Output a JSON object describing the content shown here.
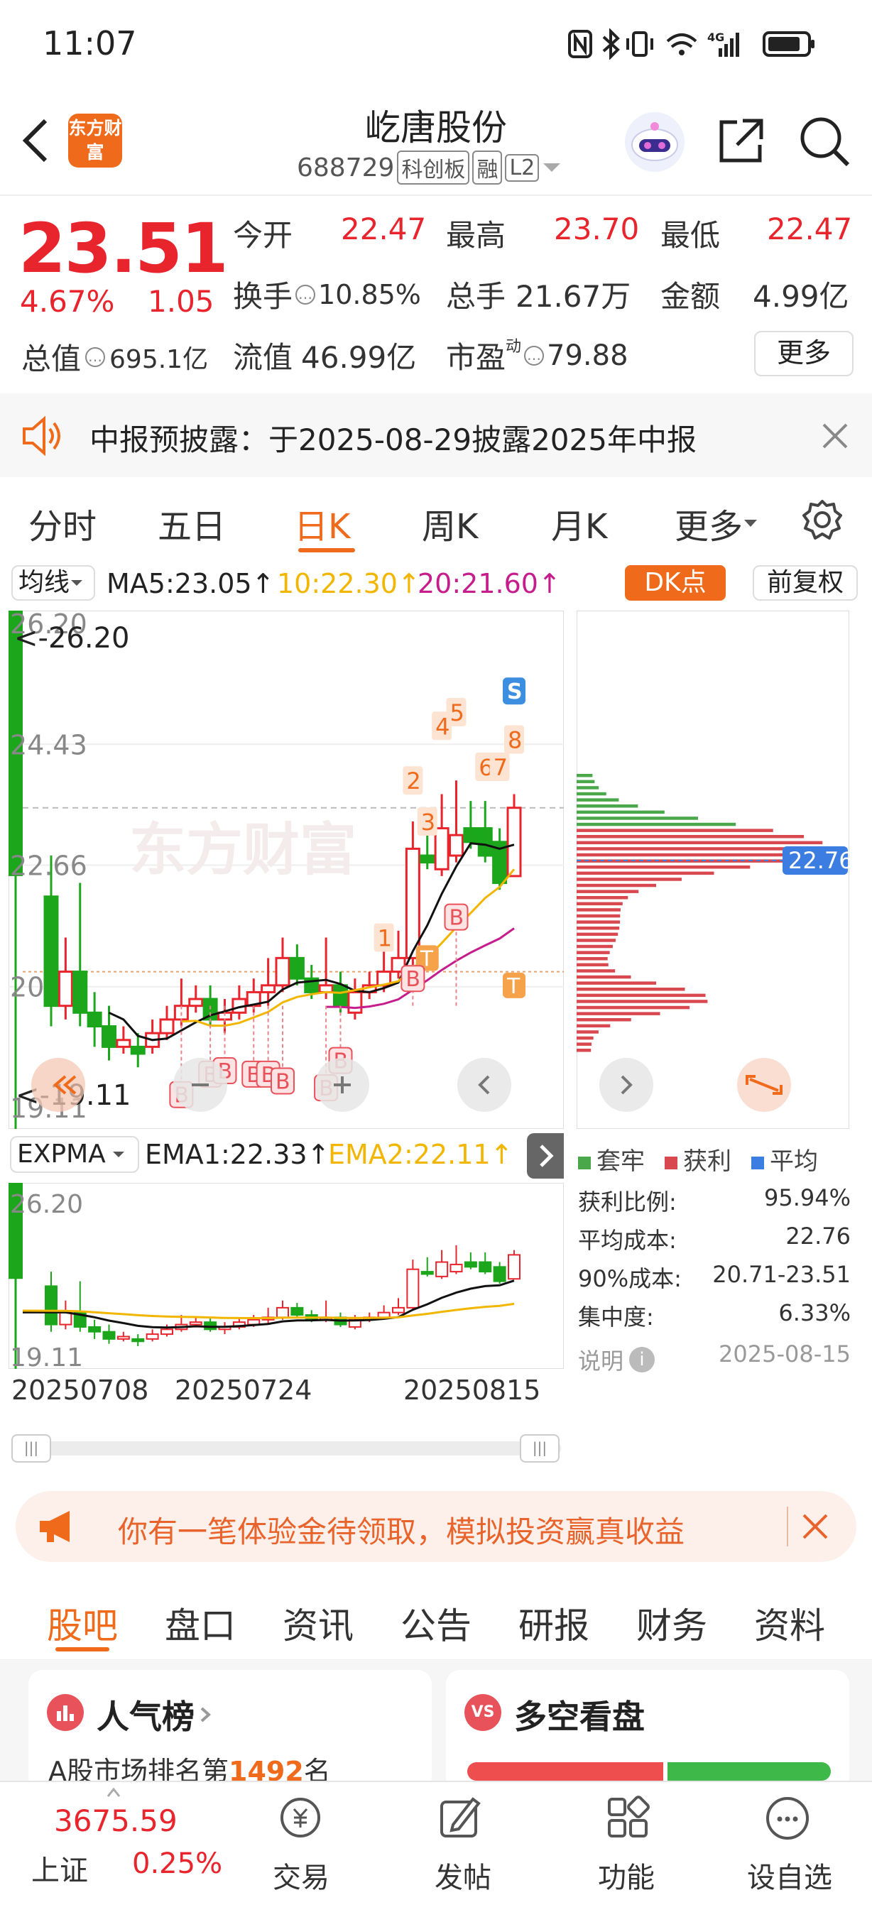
{
  "status": {
    "time": "11:07",
    "network": "4G"
  },
  "header": {
    "back_icon": "back-arrow-icon",
    "logo_text": "东方财富",
    "stock_name": "屹唐股份",
    "code": "688729",
    "badges": [
      "科创板",
      "融",
      "L2"
    ]
  },
  "quote": {
    "price": "23.51",
    "change_pct": "4.67%",
    "change": "1.05",
    "open_label": "今开",
    "open": "22.47",
    "high_label": "最高",
    "high": "23.70",
    "low_label": "最低",
    "low": "22.47",
    "turnover_label": "换手",
    "turnover": "10.85%",
    "volume_label": "总手",
    "volume": "21.67万",
    "amount_label": "金额",
    "amount": "4.99亿",
    "mktcap_label": "总值",
    "mktcap": "695.1亿",
    "float_label": "流值",
    "float_cap": "46.99亿",
    "pe_label": "市盈",
    "pe_sup": "动",
    "pe": "79.88",
    "more_button": "更多"
  },
  "notice": {
    "text": "中报预披露：于2025-08-29披露2025年中报"
  },
  "ktabs": [
    "分时",
    "五日",
    "日K",
    "周K",
    "月K",
    "更多"
  ],
  "indicator": {
    "selector": "均线",
    "ma5": "MA5:23.05↑",
    "ma10": "10:22.30↑",
    "ma20": "20:21.60↑",
    "dk_button": "DK点",
    "adjust_button": "前复权"
  },
  "main_chart": {
    "y_labels": [
      "26.20",
      "24.43",
      "22.66",
      "20.88",
      "19.11"
    ],
    "max_label": "26.20",
    "min_label": "19.11",
    "markers_num": [
      "1",
      "2",
      "3",
      "4",
      "5",
      "6",
      "7",
      "8"
    ],
    "marker_s": "S",
    "marker_t": "T",
    "marker_b": "B",
    "watermark": "东方财富"
  },
  "sub_indicator": {
    "selector": "EXPMA",
    "ema1": "EMA1:22.33↑",
    "ema2": "EMA2:22.11↑",
    "y_top": "26.20",
    "y_bottom": "19.11"
  },
  "dates": [
    "20250708",
    "20250724",
    "20250815"
  ],
  "chips": {
    "avg_cost_tag": "22.76",
    "legend": [
      "套牢",
      "获利",
      "平均"
    ],
    "rows": [
      {
        "label": "获利比例:",
        "value": "95.94%"
      },
      {
        "label": "平均成本:",
        "value": "22.76"
      },
      {
        "label": "90%成本:",
        "value": "20.71-23.51"
      },
      {
        "label": "集中度:",
        "value": "6.33%"
      }
    ],
    "explain": "说明",
    "date": "2025-08-15"
  },
  "promo": {
    "text": "你有一笔体验金待领取，模拟投资赢真收益"
  },
  "bar_tabs": [
    "股吧",
    "盘口",
    "资讯",
    "公告",
    "研报",
    "财务",
    "资料"
  ],
  "cards": {
    "popular_title": "人气榜",
    "popular_rank_prefix": "A股市场排名第",
    "popular_rank": "1492",
    "popular_rank_suffix": "名",
    "vs_badge": "VS",
    "longshort_title": "多空看盘"
  },
  "bottom_nav": {
    "index_value": "3675.59",
    "index_name": "上证",
    "index_change": "0.25%",
    "items": [
      "交易",
      "发帖",
      "功能",
      "设自选"
    ]
  },
  "colors": {
    "up": "#e8242c",
    "down": "#1ba61b",
    "accent": "#f06a1b",
    "ma10": "#f2b600",
    "ma20": "#c51d8c"
  },
  "chart_data": {
    "type": "candlestick",
    "series": [
      {
        "name": "MA5",
        "value": 23.05
      },
      {
        "name": "MA10",
        "value": 22.3
      },
      {
        "name": "MA20",
        "value": 21.6
      }
    ],
    "ylim": [
      19.11,
      26.2
    ],
    "candles": [
      [
        22.2,
        20.6,
        22.8,
        20.3
      ],
      [
        20.6,
        21.1,
        21.6,
        20.4
      ],
      [
        21.1,
        20.5,
        22.4,
        20.3
      ],
      [
        20.5,
        20.3,
        20.8,
        20.0
      ],
      [
        20.3,
        20.0,
        20.6,
        19.8
      ],
      [
        20.0,
        20.1,
        20.3,
        19.9
      ],
      [
        20.0,
        19.9,
        20.2,
        19.7
      ],
      [
        20.0,
        20.2,
        20.4,
        19.9
      ],
      [
        20.2,
        20.4,
        20.6,
        20.1
      ],
      [
        20.4,
        20.6,
        21.0,
        20.3
      ],
      [
        20.6,
        20.7,
        20.9,
        20.5
      ],
      [
        20.7,
        20.4,
        20.9,
        20.3
      ],
      [
        20.4,
        20.5,
        20.7,
        20.2
      ],
      [
        20.5,
        20.7,
        20.9,
        20.4
      ],
      [
        20.6,
        20.8,
        21.0,
        20.5
      ],
      [
        20.8,
        20.9,
        21.3,
        20.6
      ],
      [
        20.9,
        21.3,
        21.6,
        20.8
      ],
      [
        21.3,
        21.0,
        21.5,
        20.9
      ],
      [
        21.0,
        20.8,
        21.2,
        20.7
      ],
      [
        20.8,
        20.9,
        21.6,
        20.7
      ],
      [
        20.9,
        20.6,
        21.1,
        20.5
      ],
      [
        20.5,
        20.8,
        21.0,
        20.4
      ],
      [
        20.8,
        20.9,
        21.1,
        20.7
      ],
      [
        20.9,
        21.1,
        21.4,
        20.8
      ],
      [
        21.1,
        21.3,
        21.7,
        21.0
      ],
      [
        21.3,
        22.9,
        23.3,
        21.2
      ],
      [
        22.8,
        22.7,
        23.4,
        22.6
      ],
      [
        22.6,
        23.2,
        23.7,
        22.5
      ],
      [
        22.8,
        23.1,
        23.9,
        22.7
      ],
      [
        23.2,
        23.0,
        23.6,
        22.9
      ],
      [
        23.2,
        22.8,
        23.6,
        22.7
      ],
      [
        23.0,
        22.4,
        23.2,
        22.3
      ],
      [
        22.5,
        23.5,
        23.7,
        22.5
      ]
    ]
  }
}
